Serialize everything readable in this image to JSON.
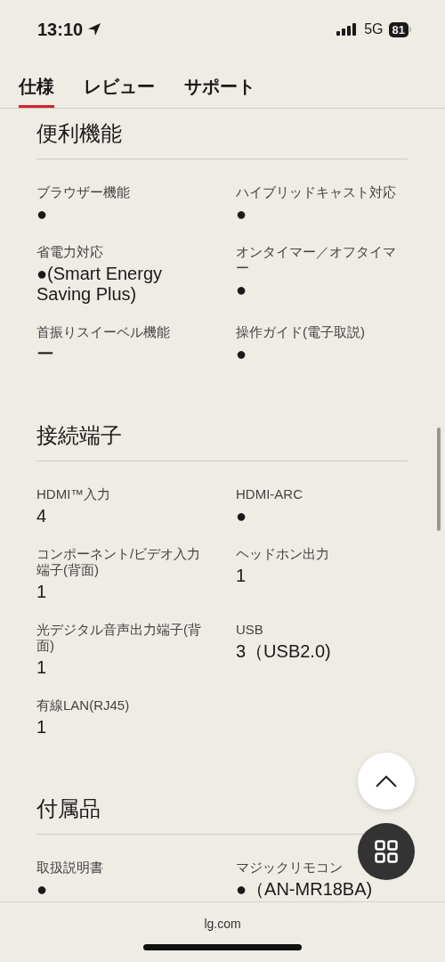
{
  "status_bar": {
    "time": "13:10",
    "network": "5G",
    "battery": "81"
  },
  "tabs": [
    {
      "label": "仕様",
      "selected": true
    },
    {
      "label": "レビュー",
      "selected": false
    },
    {
      "label": "サポート",
      "selected": false
    }
  ],
  "sections": [
    {
      "title": "便利機能",
      "items": [
        {
          "label": "ブラウザー機能",
          "value": "●"
        },
        {
          "label": "ハイブリッドキャスト対応",
          "value": "●"
        },
        {
          "label": "省電力対応",
          "value": "●(Smart Energy Saving Plus)"
        },
        {
          "label": "オンタイマー／オフタイマー",
          "value": "●"
        },
        {
          "label": "首振りスイーベル機能",
          "value": "ー"
        },
        {
          "label": "操作ガイド(電子取説)",
          "value": "●"
        }
      ]
    },
    {
      "title": "接続端子",
      "items": [
        {
          "label": "HDMI™入力",
          "value": "4"
        },
        {
          "label": "HDMI-ARC",
          "value": "●"
        },
        {
          "label": "コンポーネント/ビデオ入力端子(背面)",
          "value": "1"
        },
        {
          "label": "ヘッドホン出力",
          "value": "1"
        },
        {
          "label": "光デジタル音声出力端子(背面)",
          "value": "1"
        },
        {
          "label": "USB",
          "value": "3（USB2.0)"
        },
        {
          "label": "有線LAN(RJ45)",
          "value": "1"
        }
      ]
    },
    {
      "title": "付属品",
      "items": [
        {
          "label": "取扱説明書",
          "value": "●"
        },
        {
          "label": "マジックリモコン",
          "value": "●（AN-MR18BA)"
        }
      ]
    }
  ],
  "address_bar": {
    "domain": "lg.com"
  }
}
